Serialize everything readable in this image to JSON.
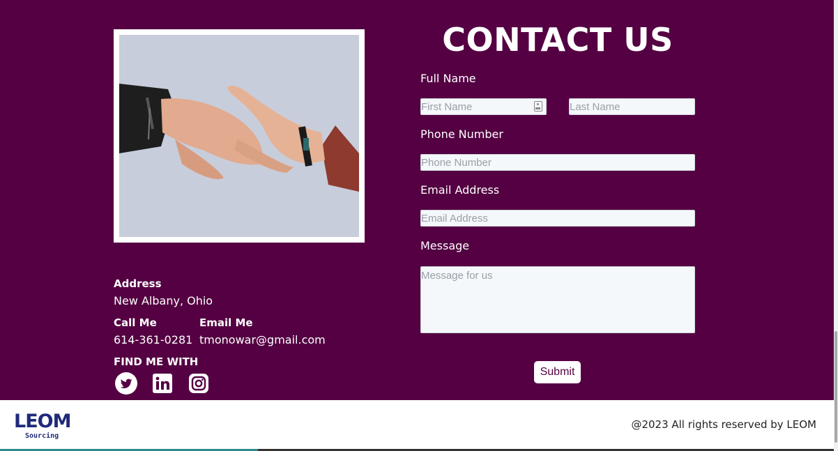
{
  "contact": {
    "title": "CONTACT US",
    "full_name_label": "Full Name",
    "first_name_placeholder": "First Name",
    "last_name_placeholder": "Last Name",
    "phone_label": "Phone Number",
    "phone_placeholder": "Phone Number",
    "email_label": "Email Address",
    "email_placeholder": "Email Address",
    "message_label": "Message",
    "message_placeholder": "Message for us",
    "submit_label": "Submit"
  },
  "info": {
    "address_label": "Address",
    "address_value": "New Albany, Ohio",
    "call_label": "Call Me",
    "call_value": "614-361-0281",
    "email_label": "Email Me",
    "email_value": "tmonowar@gmail.com",
    "social_label": "FIND ME WITH",
    "social_icons": [
      "twitter-icon",
      "linkedin-icon",
      "instagram-icon"
    ]
  },
  "footer": {
    "logo_text": "LEOM",
    "logo_subtext": "Sourcing",
    "copyright": "@2023 All rights reserved by LEOM"
  },
  "colors": {
    "section_bg": "#540042",
    "text": "#ffffff",
    "logo": "#1f2a7a"
  }
}
